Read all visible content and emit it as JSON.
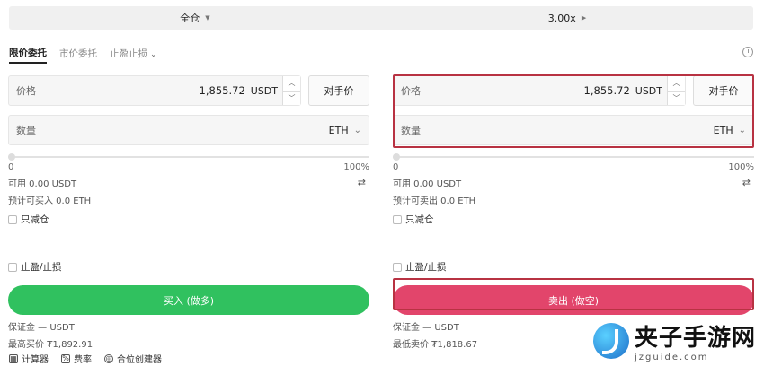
{
  "topbar": {
    "margin_mode": "全仓",
    "leverage": "3.00x"
  },
  "tabs": {
    "limit": "限价委托",
    "market": "市价委托",
    "tpsl": "止盈止损"
  },
  "buy": {
    "price_label": "价格",
    "price_value": "1,855.72",
    "price_unit": "USDT",
    "counterparty_btn": "对手价",
    "qty_label": "数量",
    "qty_unit": "ETH",
    "slider_min": "0",
    "slider_max": "100%",
    "available": "可用 0.00 USDT",
    "estimate": "预计可买入 0.0 ETH",
    "reduce_only": "只减仓",
    "tpsl": "止盈/止损",
    "action": "买入 (做多)",
    "margin": "保证金 — USDT",
    "limit_price": "最高买价 ₮1,892.91"
  },
  "sell": {
    "price_label": "价格",
    "price_value": "1,855.72",
    "price_unit": "USDT",
    "counterparty_btn": "对手价",
    "qty_label": "数量",
    "qty_unit": "ETH",
    "slider_min": "0",
    "slider_max": "100%",
    "available": "可用 0.00 USDT",
    "estimate": "预计可卖出 0.0 ETH",
    "reduce_only": "只减仓",
    "tpsl": "止盈/止损",
    "action": "卖出 (做空)",
    "margin": "保证金 — USDT",
    "limit_price": "最低卖价 ₮1,818.67"
  },
  "tools": {
    "calculator": "计算器",
    "fees": "费率",
    "position_builder": "合位创建器"
  },
  "watermark": {
    "title": "夹子手游网",
    "url": "jzguide.com"
  },
  "colors": {
    "buy": "#30c15f",
    "sell": "#e2456b",
    "highlight": "#b83242"
  },
  "icons": [
    "caret-down-icon",
    "caret-right-icon",
    "clock-icon",
    "chevron-down-icon",
    "swap-icon",
    "calculator-icon",
    "fee-icon",
    "position-builder-icon"
  ]
}
